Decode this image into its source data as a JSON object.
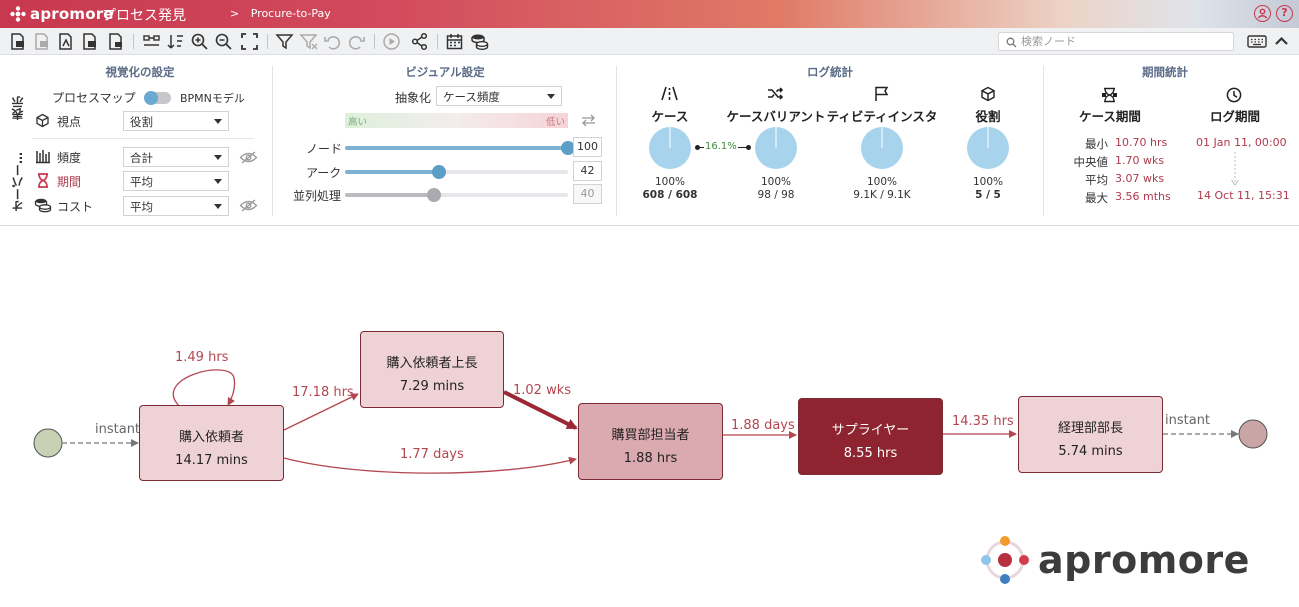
{
  "header": {
    "brand": "apromore",
    "app_title": "プロセス発見",
    "breadcrumb_sep": ">",
    "breadcrumb": "Procure-to-Pay",
    "colors": {
      "brand": "#c8384e"
    }
  },
  "toolbar": {
    "search_placeholder": "検索ノード"
  },
  "viz_settings": {
    "title": "視覚化の設定",
    "display_label": "表示",
    "overlay_label": "オーバー…",
    "process_map": "プロセスマップ",
    "bpmn_model": "BPMNモデル",
    "perspective_label": "視点",
    "perspective_value": "役割",
    "frequency_label": "頻度",
    "frequency_value": "合計",
    "duration_label": "期間",
    "duration_value": "平均",
    "cost_label": "コスト",
    "cost_value": "平均"
  },
  "visual_settings": {
    "title": "ビジュアル設定",
    "abstraction_label": "抽象化",
    "abstraction_value": "ケース頻度",
    "high": "高い",
    "low": "低い",
    "node_label": "ノード",
    "node_value": "100",
    "node_level": 1.0,
    "arc_label": "アーク",
    "arc_value": "42",
    "arc_level": 0.42,
    "parallel_label": "並列処理",
    "parallel_value": "40",
    "parallel_level": 0.4
  },
  "log_stats": {
    "title": "ログ統計",
    "items": [
      {
        "label": "ケース",
        "icon": "road-icon",
        "pct": "100%",
        "count": "608 / 608",
        "fraction": 1.0,
        "bold": true
      },
      {
        "label": "ケースバリアント",
        "icon": "shuffle-icon",
        "pct": "100%",
        "count": "98 / 98",
        "fraction": 1.0,
        "bold": false
      },
      {
        "label": "ティビティインスタ",
        "icon": "flag-icon",
        "pct": "100%",
        "count": "9.1K / 9.1K",
        "fraction": 1.0,
        "bold": false
      },
      {
        "label": "役割",
        "icon": "cube-icon",
        "pct": "100%",
        "count": "5 / 5",
        "fraction": 1.0,
        "bold": true
      }
    ],
    "variant_ratio": "16.1%",
    "pie_color": "#a7d3ec"
  },
  "period_stats": {
    "title": "期間統計",
    "case_duration_label": "ケース期間",
    "log_period_label": "ログ期間",
    "rows": [
      {
        "key": "最小",
        "value": "10.70 hrs"
      },
      {
        "key": "中央値",
        "value": "1.70 wks"
      },
      {
        "key": "平均",
        "value": "3.07 wks"
      },
      {
        "key": "最大",
        "value": "3.56 mths"
      }
    ],
    "log_start": "01 Jan 11, 00:00",
    "log_end": "14 Oct 11, 15:31"
  },
  "process_map": {
    "nodes": [
      {
        "id": "requester",
        "name": "購入依頼者",
        "value": "14.17 mins",
        "fill": "#efd2d6"
      },
      {
        "id": "req_manager",
        "name": "購入依頼者上長",
        "value": "7.29 mins",
        "fill": "#efd2d6"
      },
      {
        "id": "purchasing",
        "name": "購買部担当者",
        "value": "1.88 hrs",
        "fill": "#dba9b0"
      },
      {
        "id": "supplier",
        "name": "サプライヤー",
        "value": "8.55 hrs",
        "fill": "#8e2430",
        "text_color": "#ffffff"
      },
      {
        "id": "finance",
        "name": "経理部部長",
        "value": "5.74 mins",
        "fill": "#efd2d6"
      }
    ],
    "edges": [
      {
        "label": "instant"
      },
      {
        "label": "1.49 hrs"
      },
      {
        "label": "17.18 hrs"
      },
      {
        "label": "1.02 wks"
      },
      {
        "label": "1.77 days"
      },
      {
        "label": "1.88 days"
      },
      {
        "label": "14.35 hrs"
      },
      {
        "label": "instant"
      }
    ],
    "start_color": "#c9d1b4",
    "end_color": "#c9a5a5",
    "edge_color": "#b3464f"
  },
  "watermark": {
    "text": "apromore"
  }
}
